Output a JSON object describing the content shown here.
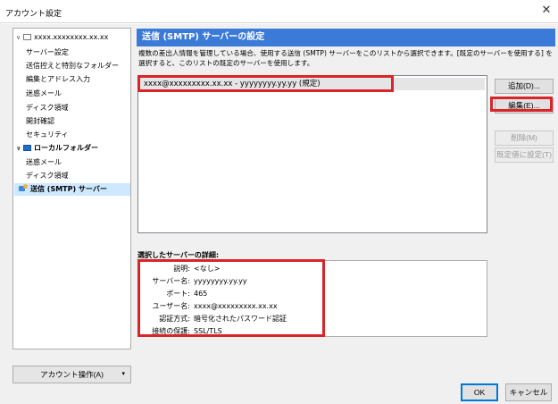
{
  "window": {
    "title": "アカウント設定",
    "close_glyph": "✕"
  },
  "sidebar": {
    "items": [
      {
        "label": "xxxx.xxxxxxxx.xx.xx",
        "level": 1
      },
      {
        "label": "サーバー設定",
        "level": 2
      },
      {
        "label": "送信控えと特別なフォルダー",
        "level": 2
      },
      {
        "label": "編集とアドレス入力",
        "level": 2
      },
      {
        "label": "迷惑メール",
        "level": 2
      },
      {
        "label": "ディスク領域",
        "level": 2
      },
      {
        "label": "開封確認",
        "level": 2
      },
      {
        "label": "セキュリティ",
        "level": 2
      },
      {
        "label": "ローカルフォルダー",
        "level": 1
      },
      {
        "label": "迷惑メール",
        "level": 2
      },
      {
        "label": "ディスク領域",
        "level": 2
      },
      {
        "label": "送信 (SMTP) サーバー",
        "level": 2,
        "selected": true
      }
    ],
    "account_actions": "アカウント操作(A)"
  },
  "panel": {
    "title": "送信 (SMTP) サーバーの設定",
    "description": "複数の差出人情報を管理している場合、使用する送信 (SMTP) サーバーをこのリストから選択できます。[既定のサーバーを使用する] を選択すると、このリストの既定のサーバーを使用します。",
    "servers": [
      "xxxx@xxxxxxxxx.xx.xx - yyyyyyyy.yy.yy (規定)"
    ],
    "buttons": {
      "add": "追加(D)...",
      "edit": "編集(E)...",
      "remove": "削除(M)",
      "set_default": "既定値に設定(T)"
    },
    "details_title": "選択したサーバーの詳細:",
    "details": [
      {
        "label": "説明:",
        "value": "<なし>"
      },
      {
        "label": "サーバー名:",
        "value": "yyyyyyyy.yy.yy"
      },
      {
        "label": "ポート:",
        "value": "465"
      },
      {
        "label": "ユーザー名:",
        "value": "xxxx@xxxxxxxxx.xx.xx"
      },
      {
        "label": "認証方式:",
        "value": "暗号化されたパスワード認証"
      },
      {
        "label": "接続の保護:",
        "value": "SSL/TLS"
      }
    ]
  },
  "footer": {
    "ok": "OK",
    "cancel": "キャンセル"
  },
  "colors": {
    "header_blue": "#3b7ad6",
    "highlight_red": "#d9252a",
    "selected_bg": "#cde8ff"
  }
}
